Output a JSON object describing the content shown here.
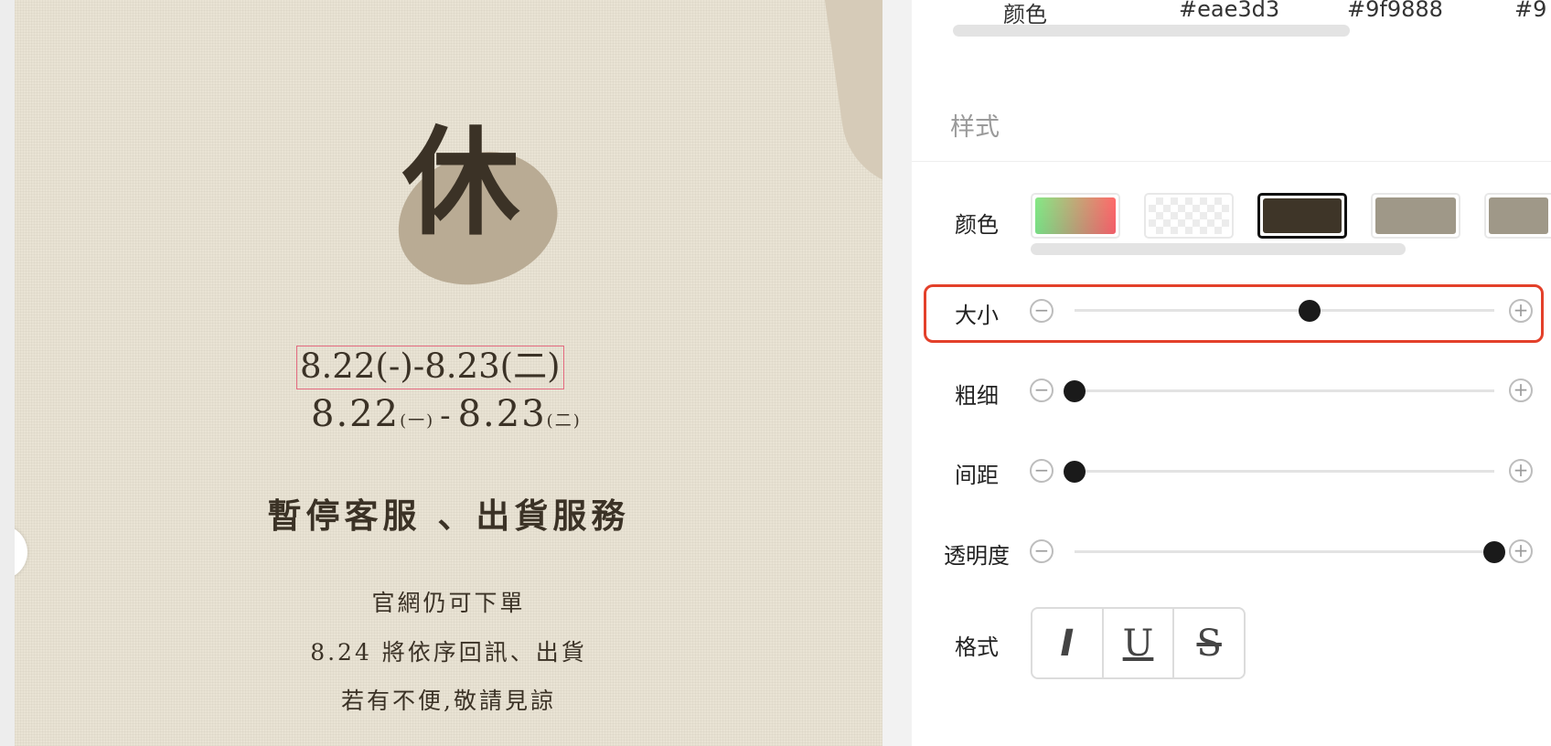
{
  "canvas": {
    "big_char": "休",
    "date_selected": "8.22(-)-8.23(二)",
    "date_display": {
      "start": "8.22",
      "start_day": "(一)",
      "dash": "-",
      "end": "8.23",
      "end_day": "(二)"
    },
    "headline": "暫停客服 、出貨服務",
    "lines": [
      "官網仍可下單",
      "8.24 將依序回訊、出貨",
      "若有不便,敬請見諒"
    ]
  },
  "panel": {
    "top_colors": {
      "label": "颜色",
      "values": [
        "#eae3d3",
        "#9f9888",
        "#9"
      ]
    },
    "section_title": "样式",
    "color_label": "颜色",
    "swatches": [
      {
        "name": "gradient-picker",
        "color": "gradient"
      },
      {
        "name": "transparent",
        "color": "transparent"
      },
      {
        "name": "dark-brown",
        "color": "#3e3528",
        "selected": true
      },
      {
        "name": "grey",
        "color": "#9f9888"
      },
      {
        "name": "grey-2",
        "color": "#9f9888"
      }
    ],
    "sliders": [
      {
        "label": "大小",
        "value": 0.56,
        "highlighted": true
      },
      {
        "label": "粗细",
        "value": 0.0
      },
      {
        "label": "间距",
        "value": 0.0
      },
      {
        "label": "透明度",
        "value": 1.0
      }
    ],
    "format_label": "格式",
    "format_buttons": [
      "I",
      "U",
      "S"
    ],
    "step_minus": "−",
    "step_plus": "+"
  }
}
